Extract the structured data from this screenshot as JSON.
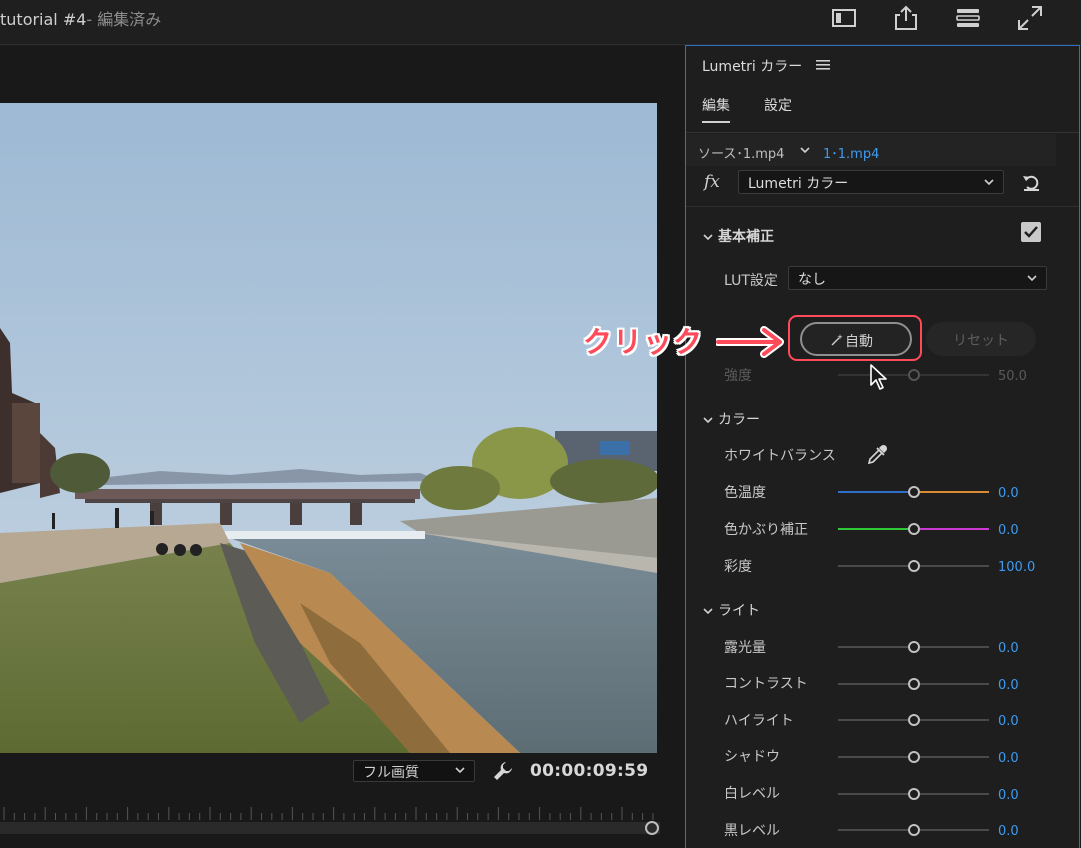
{
  "window": {
    "title": "tutorial #4",
    "title_suffix": "- 編集済み"
  },
  "top_icons": [
    "panel-layout-icon",
    "export-icon",
    "workspace-icon",
    "fullscreen-icon"
  ],
  "monitor": {
    "quality": "フル画質",
    "timecode": "00:00:09:59"
  },
  "panel": {
    "title": "Lumetri カラー",
    "tabs": [
      "編集",
      "設定"
    ],
    "source_label": "ソース･1.mp4",
    "clip_label": "1･1.mp4",
    "fx_label": "fx",
    "effect": "Lumetri カラー",
    "basic": {
      "header": "基本補正",
      "enabled": true,
      "lut_label": "LUT設定",
      "lut_value": "なし",
      "auto_label": "自動",
      "reset_label": "リセット",
      "intensity_label": "強度",
      "intensity_value": "50.0"
    },
    "color": {
      "header": "カラー",
      "white_balance_label": "ホワイトバランス",
      "temperature_label": "色温度",
      "temperature_value": "0.0",
      "tint_label": "色かぶり補正",
      "tint_value": "0.0",
      "saturation_label": "彩度",
      "saturation_value": "100.0"
    },
    "light": {
      "header": "ライト",
      "exposure_label": "露光量",
      "exposure_value": "0.0",
      "contrast_label": "コントラスト",
      "contrast_value": "0.0",
      "highlights_label": "ハイライト",
      "highlights_value": "0.0",
      "shadows_label": "シャドウ",
      "shadows_value": "0.0",
      "whites_label": "白レベル",
      "whites_value": "0.0",
      "blacks_label": "黒レベル",
      "blacks_value": "0.0"
    }
  },
  "annotation": {
    "text": "クリック",
    "color": "#ff4a59"
  },
  "colors": {
    "accent_blue": "#3e9bf0",
    "panel_border": "#2d6fc0"
  }
}
